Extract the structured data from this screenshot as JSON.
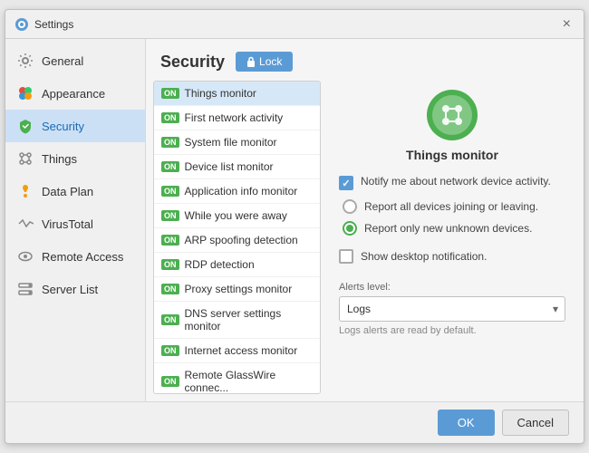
{
  "window": {
    "title": "Settings",
    "close_label": "×"
  },
  "sidebar": {
    "items": [
      {
        "id": "general",
        "label": "General",
        "icon": "gear"
      },
      {
        "id": "appearance",
        "label": "Appearance",
        "icon": "circles"
      },
      {
        "id": "security",
        "label": "Security",
        "icon": "shield",
        "active": true
      },
      {
        "id": "things",
        "label": "Things",
        "icon": "links"
      },
      {
        "id": "dataplan",
        "label": "Data Plan",
        "icon": "bell"
      },
      {
        "id": "virustotal",
        "label": "VirusTotal",
        "icon": "arrows"
      },
      {
        "id": "remoteaccess",
        "label": "Remote Access",
        "icon": "eye"
      },
      {
        "id": "serverlist",
        "label": "Server List",
        "icon": "server"
      }
    ]
  },
  "panel": {
    "title": "Security",
    "lock_button": "Lock"
  },
  "monitors": [
    {
      "label": "Things monitor",
      "active": true
    },
    {
      "label": "First network activity",
      "active": false
    },
    {
      "label": "System file monitor",
      "active": false
    },
    {
      "label": "Device list monitor",
      "active": false
    },
    {
      "label": "Application info monitor",
      "active": false
    },
    {
      "label": "While you were away",
      "active": false
    },
    {
      "label": "ARP spoofing detection",
      "active": false
    },
    {
      "label": "RDP detection",
      "active": false
    },
    {
      "label": "Proxy settings monitor",
      "active": false
    },
    {
      "label": "DNS server settings monitor",
      "active": false
    },
    {
      "label": "Internet access monitor",
      "active": false
    },
    {
      "label": "Remote GlassWire connec...",
      "active": false
    }
  ],
  "detail": {
    "icon_symbol": "✦",
    "name": "Things monitor",
    "notify_label": "Notify me about network device activity.",
    "radio_option1": "Report all devices joining or leaving.",
    "radio_option2": "Report only new unknown devices.",
    "show_notif_label": "Show desktop notification.",
    "alerts_label": "Alerts level:",
    "alerts_value": "Logs",
    "alerts_note": "Logs alerts are read by default."
  },
  "footer": {
    "ok_label": "OK",
    "cancel_label": "Cancel"
  }
}
